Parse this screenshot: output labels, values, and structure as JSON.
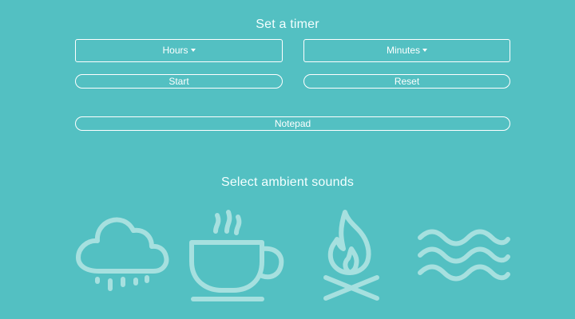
{
  "timer": {
    "heading": "Set a timer",
    "hours_label": "Hours",
    "minutes_label": "Minutes",
    "start_label": "Start",
    "reset_label": "Reset"
  },
  "notepad": {
    "label": "Notepad"
  },
  "ambient": {
    "heading": "Select ambient sounds",
    "sounds": [
      {
        "name": "rain",
        "icon": "rain-cloud-icon"
      },
      {
        "name": "coffee",
        "icon": "coffee-cup-icon"
      },
      {
        "name": "fire",
        "icon": "campfire-icon"
      },
      {
        "name": "waves",
        "icon": "waves-icon"
      }
    ]
  },
  "colors": {
    "background": "#53c0c2",
    "foreground": "#ffffff",
    "icon": "#a6e0df"
  }
}
